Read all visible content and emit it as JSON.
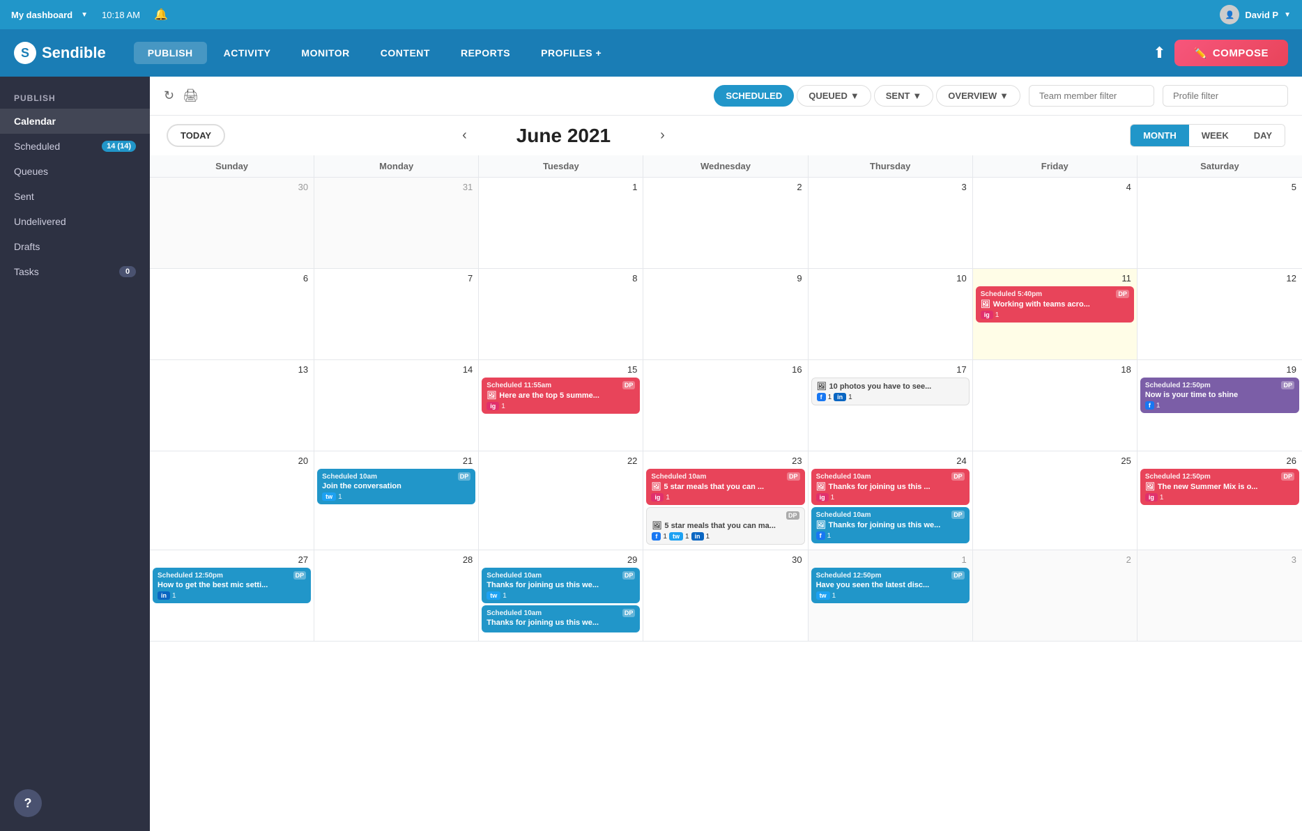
{
  "topbar": {
    "dashboard_label": "My dashboard",
    "time": "10:18 AM",
    "user": "David P"
  },
  "nav": {
    "logo": "Sendible",
    "items": [
      {
        "label": "PUBLISH",
        "active": true
      },
      {
        "label": "ACTIVITY",
        "active": false
      },
      {
        "label": "MONITOR",
        "active": false
      },
      {
        "label": "CONTENT",
        "active": false
      },
      {
        "label": "REPORTS",
        "active": false
      },
      {
        "label": "PROFILES +",
        "active": false
      }
    ],
    "compose_label": "COMPOSE"
  },
  "sidebar": {
    "section": "PUBLISH",
    "items": [
      {
        "label": "Calendar",
        "active": true,
        "badge": null
      },
      {
        "label": "Scheduled",
        "active": false,
        "badge": "14 (14)"
      },
      {
        "label": "Queues",
        "active": false,
        "badge": null
      },
      {
        "label": "Sent",
        "active": false,
        "badge": null
      },
      {
        "label": "Undelivered",
        "active": false,
        "badge": null
      },
      {
        "label": "Drafts",
        "active": false,
        "badge": null
      },
      {
        "label": "Tasks",
        "active": false,
        "badge": "0"
      }
    ]
  },
  "toolbar": {
    "tabs": [
      {
        "label": "SCHEDULED",
        "active": true
      },
      {
        "label": "QUEUED",
        "active": false,
        "dropdown": true
      },
      {
        "label": "SENT",
        "active": false,
        "dropdown": true
      },
      {
        "label": "OVERVIEW",
        "active": false,
        "dropdown": true
      }
    ],
    "team_filter_placeholder": "Team member filter",
    "profile_filter_placeholder": "Profile filter"
  },
  "calendar": {
    "month_label": "June 2021",
    "today_label": "TODAY",
    "view_buttons": [
      "MONTH",
      "WEEK",
      "DAY"
    ],
    "active_view": "MONTH",
    "day_headers": [
      "Sunday",
      "Monday",
      "Tuesday",
      "Wednesday",
      "Thursday",
      "Friday",
      "Saturday"
    ],
    "rows": [
      {
        "cells": [
          {
            "date": "30",
            "month": "other",
            "events": []
          },
          {
            "date": "31",
            "month": "other",
            "events": []
          },
          {
            "date": "1",
            "month": "current",
            "events": []
          },
          {
            "date": "2",
            "month": "current",
            "events": []
          },
          {
            "date": "3",
            "month": "current",
            "events": []
          },
          {
            "date": "4",
            "month": "current",
            "events": []
          },
          {
            "date": "5",
            "month": "current",
            "events": []
          }
        ]
      },
      {
        "cells": [
          {
            "date": "6",
            "month": "current",
            "events": []
          },
          {
            "date": "7",
            "month": "current",
            "events": []
          },
          {
            "date": "8",
            "month": "current",
            "events": []
          },
          {
            "date": "9",
            "month": "current",
            "events": []
          },
          {
            "date": "10",
            "month": "current",
            "events": []
          },
          {
            "date": "11",
            "month": "today",
            "events": [
              {
                "type": "pink",
                "time": "Scheduled 5:40pm",
                "dp": "DP",
                "title": "Working with teams acro...",
                "icon": "🖼",
                "socials": [
                  {
                    "type": "ig",
                    "count": "1"
                  }
                ]
              }
            ]
          },
          {
            "date": "12",
            "month": "current",
            "events": []
          }
        ]
      },
      {
        "cells": [
          {
            "date": "13",
            "month": "current",
            "events": []
          },
          {
            "date": "14",
            "month": "current",
            "events": []
          },
          {
            "date": "15",
            "month": "current",
            "events": [
              {
                "type": "pink",
                "time": "Scheduled 11:55am",
                "dp": "DP",
                "title": "Here are the top 5 summe...",
                "icon": "🖼",
                "socials": [
                  {
                    "type": "ig",
                    "count": "1"
                  }
                ]
              }
            ]
          },
          {
            "date": "16",
            "month": "current",
            "events": []
          },
          {
            "date": "17",
            "month": "current",
            "events": [
              {
                "type": "gray",
                "time": "",
                "dp": "",
                "title": "10 photos you have to see...",
                "icon": "🖼",
                "socials": [
                  {
                    "type": "fb",
                    "count": "1"
                  },
                  {
                    "type": "li",
                    "count": "1"
                  }
                ]
              }
            ]
          },
          {
            "date": "18",
            "month": "current",
            "events": []
          },
          {
            "date": "19",
            "month": "current",
            "events": [
              {
                "type": "purple",
                "time": "Scheduled 12:50pm",
                "dp": "DP",
                "title": "Now is your time to shine",
                "icon": "",
                "socials": [
                  {
                    "type": "fb",
                    "count": "1"
                  }
                ]
              }
            ]
          }
        ]
      },
      {
        "cells": [
          {
            "date": "20",
            "month": "current",
            "events": []
          },
          {
            "date": "21",
            "month": "current",
            "events": [
              {
                "type": "blue",
                "time": "Scheduled 10am",
                "dp": "DP",
                "title": "Join the conversation",
                "icon": "",
                "socials": [
                  {
                    "type": "tw",
                    "count": "1"
                  }
                ]
              }
            ]
          },
          {
            "date": "22",
            "month": "current",
            "events": []
          },
          {
            "date": "23",
            "month": "current",
            "events": [
              {
                "type": "pink",
                "time": "Scheduled 10am",
                "dp": "DP",
                "title": "5 star meals that you can ...",
                "icon": "🖼",
                "socials": [
                  {
                    "type": "ig",
                    "count": "1"
                  }
                ]
              },
              {
                "type": "gray",
                "time": "",
                "dp": "DP",
                "title": "5 star meals that you can ma...",
                "icon": "🖼",
                "socials": [
                  {
                    "type": "fb",
                    "count": "1"
                  },
                  {
                    "type": "tw",
                    "count": "1"
                  },
                  {
                    "type": "li",
                    "count": "1"
                  }
                ]
              }
            ]
          },
          {
            "date": "24",
            "month": "current",
            "events": [
              {
                "type": "pink",
                "time": "Scheduled 10am",
                "dp": "DP",
                "title": "Thanks for joining us this ...",
                "icon": "🖼",
                "socials": [
                  {
                    "type": "ig",
                    "count": "1"
                  }
                ]
              },
              {
                "type": "blue",
                "time": "Scheduled 10am",
                "dp": "DP",
                "title": "Thanks for joining us this we...",
                "icon": "🖼",
                "socials": [
                  {
                    "type": "fb",
                    "count": "1"
                  }
                ]
              }
            ]
          },
          {
            "date": "25",
            "month": "current",
            "events": []
          },
          {
            "date": "26",
            "month": "current",
            "events": [
              {
                "type": "pink",
                "time": "Scheduled 12:50pm",
                "dp": "DP",
                "title": "The new Summer Mix is o...",
                "icon": "🖼",
                "socials": [
                  {
                    "type": "ig",
                    "count": "1"
                  }
                ]
              }
            ]
          }
        ]
      },
      {
        "cells": [
          {
            "date": "27",
            "month": "current",
            "events": [
              {
                "type": "blue",
                "time": "Scheduled 12:50pm",
                "dp": "DP",
                "title": "How to get the best mic setti...",
                "icon": "",
                "socials": [
                  {
                    "type": "li",
                    "count": "1"
                  }
                ]
              }
            ]
          },
          {
            "date": "28",
            "month": "current",
            "events": []
          },
          {
            "date": "29",
            "month": "current",
            "events": [
              {
                "type": "blue",
                "time": "Scheduled 10am",
                "dp": "DP",
                "title": "Thanks for joining us this we...",
                "icon": "",
                "socials": [
                  {
                    "type": "tw",
                    "count": "1"
                  }
                ]
              },
              {
                "type": "blue",
                "time": "Scheduled 10am",
                "dp": "DP",
                "title": "Thanks for joining us this we...",
                "icon": "",
                "socials": []
              }
            ]
          },
          {
            "date": "30",
            "month": "current",
            "events": []
          },
          {
            "date": "1",
            "month": "other",
            "events": [
              {
                "type": "blue",
                "time": "Scheduled 12:50pm",
                "dp": "DP",
                "title": "Have you seen the latest disc...",
                "icon": "",
                "socials": [
                  {
                    "type": "tw",
                    "count": "1"
                  }
                ]
              }
            ]
          },
          {
            "date": "2",
            "month": "other",
            "events": []
          },
          {
            "date": "3",
            "month": "other",
            "events": []
          }
        ]
      }
    ]
  }
}
